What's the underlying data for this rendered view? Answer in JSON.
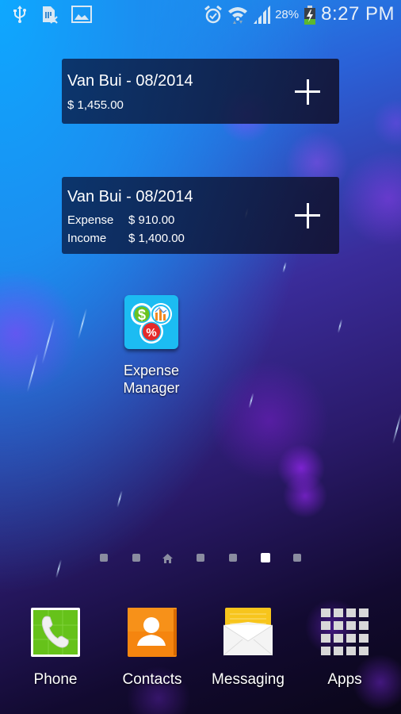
{
  "status_bar": {
    "left_icons": [
      "usb-icon",
      "sim-card-error-icon",
      "gallery-notification-icon"
    ],
    "right_icons": [
      "alarm-icon",
      "wifi-icon",
      "signal-icon",
      "battery-charging-icon"
    ],
    "battery_percent": "28%",
    "time": "8:27 PM"
  },
  "widgets": [
    {
      "title": "Van Bui - 08/2014",
      "amount": "$ 1,455.00",
      "action": "add-icon"
    },
    {
      "title": "Van Bui - 08/2014",
      "rows": [
        {
          "label": "Expense",
          "value": "$ 910.00"
        },
        {
          "label": "Income",
          "value": "$ 1,400.00"
        }
      ],
      "action": "add-icon"
    }
  ],
  "desktop_apps": [
    {
      "name": "Expense Manager",
      "line1": "Expense",
      "line2": "Manager",
      "icon": "expense-manager-icon"
    }
  ],
  "page_indicator": {
    "count": 7,
    "home_index": 2,
    "active_index": 5
  },
  "dock": [
    {
      "label": "Phone",
      "icon": "phone-icon"
    },
    {
      "label": "Contacts",
      "icon": "contacts-icon"
    },
    {
      "label": "Messaging",
      "icon": "messaging-icon"
    },
    {
      "label": "Apps",
      "icon": "apps-grid-icon"
    }
  ],
  "colors": {
    "phone_green": "#66c21a",
    "contacts_orange": "#f5850f",
    "messaging_yellow": "#f7c51c",
    "expense_icon_bg": "#1cbcf2",
    "battery_green": "#5db82e"
  }
}
